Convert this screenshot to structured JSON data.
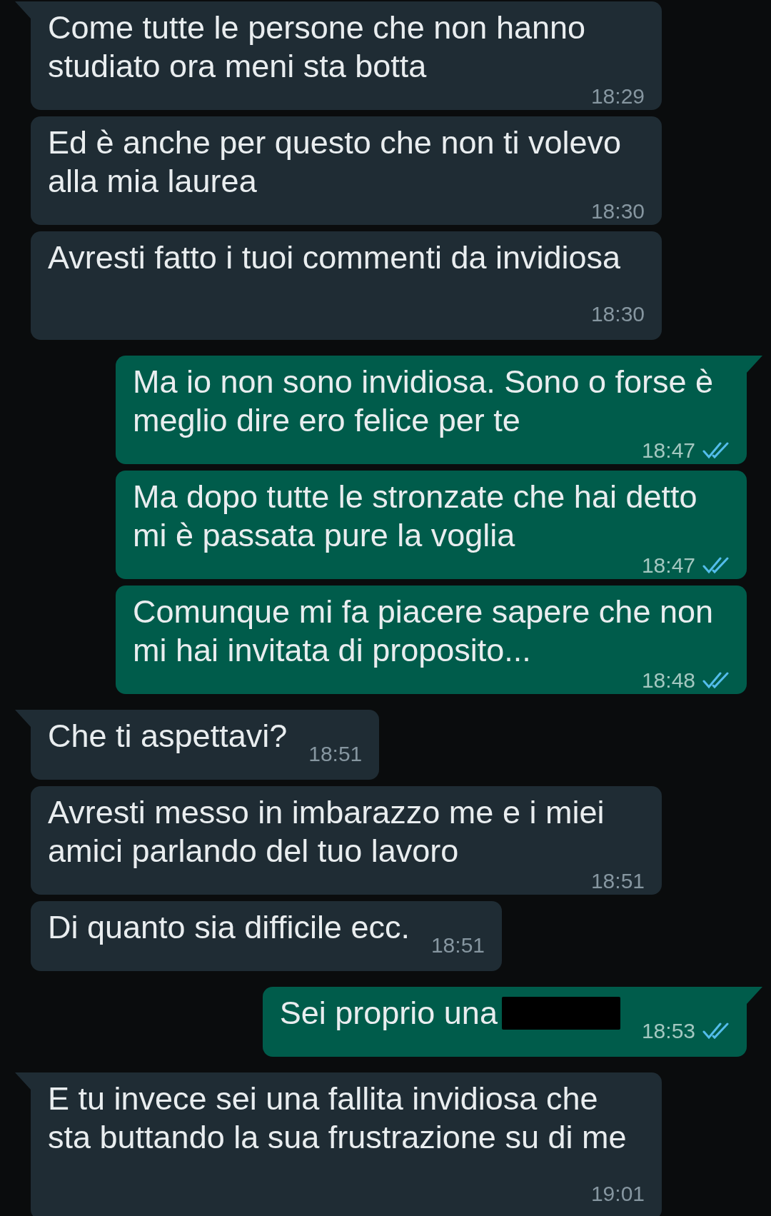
{
  "messages": [
    {
      "kind": "incoming",
      "tail": true,
      "text": "Come tutte le persone che non hanno studiato ora meni sta botta",
      "time": "18:29"
    },
    {
      "kind": "incoming",
      "tail": false,
      "text": "Ed è anche per questo che non ti volevo alla mia laurea",
      "time": "18:30"
    },
    {
      "kind": "incoming",
      "tail": false,
      "text": "Avresti fatto i tuoi commenti da invidiosa",
      "time": "18:30"
    },
    {
      "kind": "outgoing",
      "tail": true,
      "text": "Ma io non sono invidiosa. Sono o forse è meglio dire ero felice per te",
      "time": "18:47",
      "read": true
    },
    {
      "kind": "outgoing",
      "tail": false,
      "text": "Ma dopo tutte le stronzate che hai detto mi è passata pure la voglia",
      "time": "18:47",
      "read": true
    },
    {
      "kind": "outgoing",
      "tail": false,
      "text": "Comunque mi fa piacere sapere che non mi hai invitata di proposito...",
      "time": "18:48",
      "read": true
    },
    {
      "kind": "incoming",
      "tail": true,
      "text": "Che ti aspettavi?",
      "time": "18:51"
    },
    {
      "kind": "incoming",
      "tail": false,
      "text": "Avresti messo in imbarazzo me e i miei amici parlando del tuo lavoro",
      "time": "18:51"
    },
    {
      "kind": "incoming",
      "tail": false,
      "text": "Di quanto sia difficile ecc.",
      "time": "18:51"
    },
    {
      "kind": "outgoing",
      "tail": true,
      "text": "Sei proprio una",
      "redacted": true,
      "time": "18:53",
      "read": true
    },
    {
      "kind": "incoming",
      "tail": true,
      "text": "E tu invece sei una fallita invidiosa che sta buttando la sua frustrazione su di me",
      "time": "19:01"
    }
  ]
}
